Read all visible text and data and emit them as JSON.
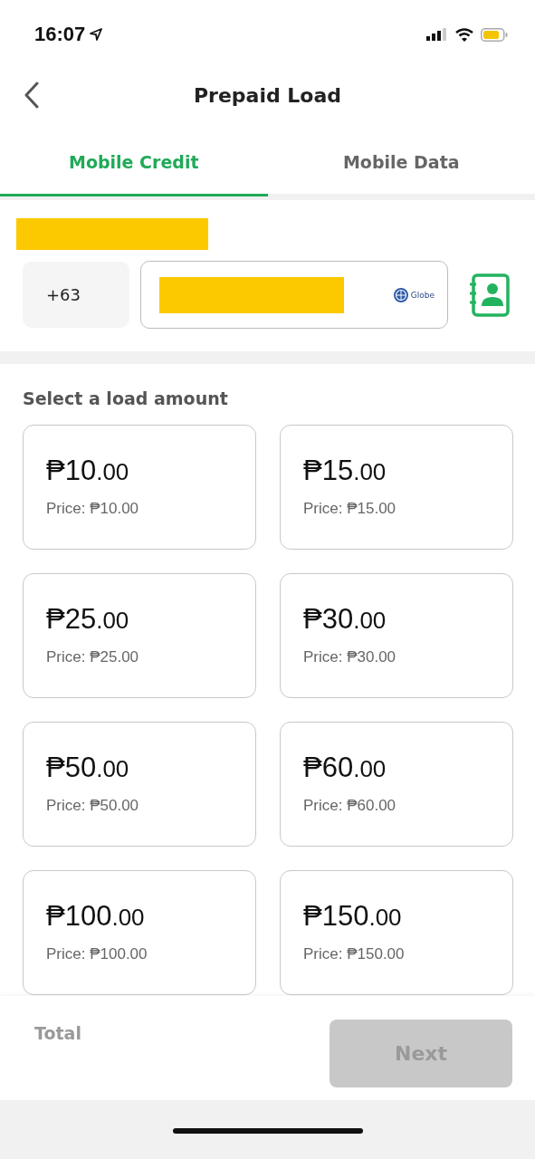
{
  "status_bar": {
    "time": "16:07"
  },
  "header": {
    "title": "Prepaid Load"
  },
  "tabs": [
    {
      "label": "Mobile Credit",
      "selected": true
    },
    {
      "label": "Mobile Data",
      "selected": false
    }
  ],
  "phone": {
    "country_code": "+63",
    "carrier": "Globe"
  },
  "section_title": "Select a load amount",
  "amounts": [
    {
      "amount": "₱10",
      "cents": ".00",
      "price": "Price: ₱10.00",
      "selected": false
    },
    {
      "amount": "₱15",
      "cents": ".00",
      "price": "Price: ₱15.00",
      "selected": false
    },
    {
      "amount": "₱25",
      "cents": ".00",
      "price": "Price: ₱25.00",
      "selected": false
    },
    {
      "amount": "₱30",
      "cents": ".00",
      "price": "Price: ₱30.00",
      "selected": false
    },
    {
      "amount": "₱50",
      "cents": ".00",
      "price": "Price: ₱50.00",
      "selected": false
    },
    {
      "amount": "₱60",
      "cents": ".00",
      "price": "Price: ₱60.00",
      "selected": false
    },
    {
      "amount": "₱100",
      "cents": ".00",
      "price": "Price: ₱100.00",
      "selected": false
    },
    {
      "amount": "₱150",
      "cents": ".00",
      "price": "Price: ₱150.00",
      "selected": false
    }
  ],
  "footer": {
    "total_label": "Total",
    "next_button": {
      "label": "Next",
      "disabled": true
    }
  }
}
